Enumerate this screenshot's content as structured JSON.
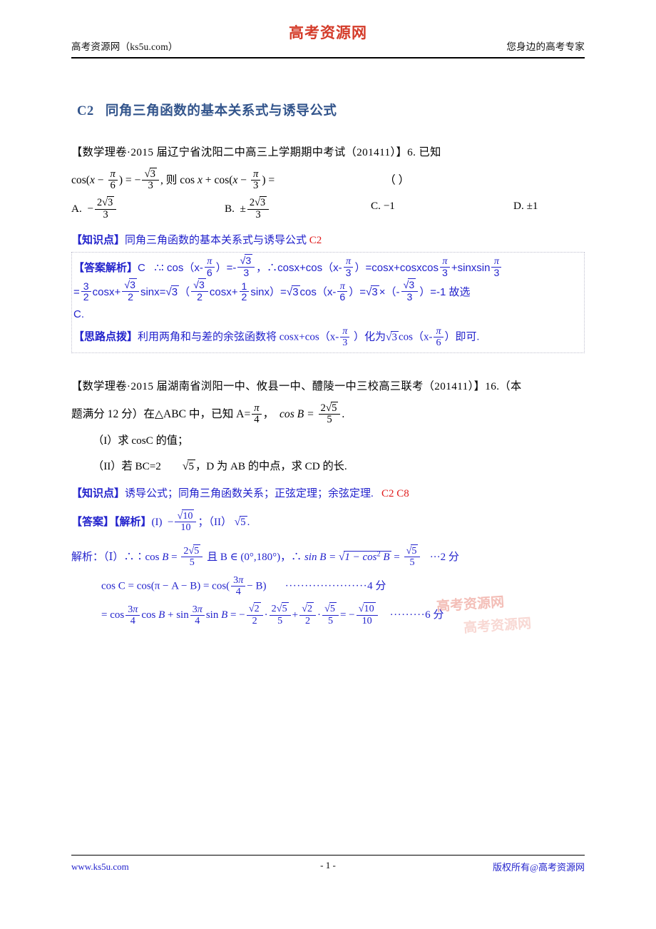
{
  "header": {
    "left": "高考资源网（ks5u.com）",
    "logo": "高考资源网",
    "right": "您身边的高考专家"
  },
  "footer": {
    "left": "www.ks5u.com",
    "center": "- 1 -",
    "right": "版权所有@高考资源网"
  },
  "watermark": {
    "text1": "高考资源网",
    "text2": "高考资源网"
  },
  "section": {
    "code": "C2",
    "title": "同角三角函数的基本关系式与诱导公式"
  },
  "problem1": {
    "source": "【数学理卷·2015 届辽宁省沈阳二中高三上学期期中考试（201411）】6.  已知",
    "stem_prefix": "cos(",
    "stem_text_ze": "则",
    "paren_marker": "（        ）",
    "options": {
      "a_label": "A.",
      "b_label": "B.",
      "c_label": "C.",
      "c_value": "−1",
      "d_label": "D.",
      "d_value": "±1",
      "a_sign": "−",
      "b_sign": "±",
      "frac_num": "2√3",
      "frac_den": "3"
    },
    "knowledge": {
      "label": "【知识点】",
      "text": "同角三角函数的基本关系式与诱导公式",
      "codes": "C2"
    },
    "answer": {
      "label": "【答案解析】",
      "choice": "C",
      "tail_c": "C."
    },
    "tip": {
      "label": "【思路点拨】",
      "text_1": "利用两角和与差的余弦函数将 cosx+cos（x-",
      "text_2": "）化为",
      "text_3": "cos（x-",
      "text_4": "）即可."
    }
  },
  "problem2": {
    "source": "【数学理卷·2015 届湖南省浏阳一中、攸县一中、醴陵一中三校高三联考（201411）】16.（本",
    "stem_line": "题满分 12 分）在△ABC 中，已知 A=",
    "stem_cosb": "cos B =",
    "part1": "（I）求 cosC 的值；",
    "part2_a": "（II）若 BC=2",
    "part2_b": "，D 为 AB 的中点，求 CD 的长.",
    "knowledge": {
      "label": "【知识点】",
      "text": "诱导公式；同角三角函数关系；正弦定理；余弦定理.",
      "codes": "C2    C8"
    },
    "answer": {
      "label": "【答案】【解析】",
      "part1_roman": "(I)",
      "part2_roman": "（II）",
      "sep": "；",
      "end": "."
    },
    "solution": {
      "lead": "解析：（Ⅰ）",
      "cosb_cond": "且 B ∈ (0°,180°)，",
      "sinb_text": "sin B =",
      "score2": "···2 分",
      "line2_lead": "cos C = cos(π − A − B) = cos(",
      "line2_tail": "− B)",
      "dots4": "·····················",
      "score4": "4 分",
      "line3_lead": "= cos",
      "dots6": "·········",
      "score6": "6 分"
    }
  },
  "colors": {
    "title_blue": "#33558c",
    "annotation_blue": "#2222cc",
    "code_red": "#e01b1b",
    "logo_red": "#d43c2a",
    "watermark_red": "#f0a9a0"
  }
}
